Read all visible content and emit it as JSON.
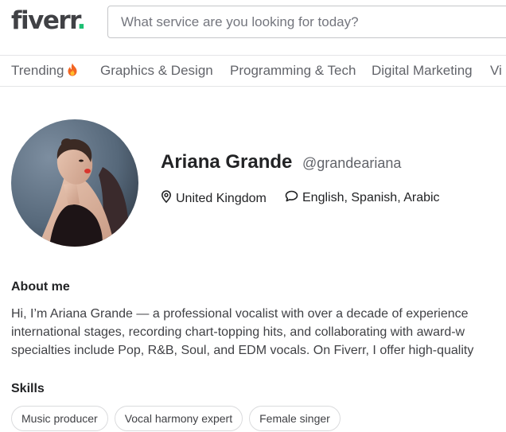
{
  "header": {
    "logo_text": "fiverr",
    "logo_dot": ".",
    "logo_dot_color": "#1dbf73",
    "search_placeholder": "What service are you looking for today?"
  },
  "nav": {
    "items": [
      {
        "label": "Trending",
        "icon": "flame-icon"
      },
      {
        "label": "Graphics & Design"
      },
      {
        "label": "Programming & Tech"
      },
      {
        "label": "Digital Marketing"
      },
      {
        "label": "Vi"
      }
    ]
  },
  "profile": {
    "name": "Ariana Grande",
    "handle": "@grandeariana",
    "location": "United Kingdom",
    "location_icon": "location-pin-icon",
    "languages": "English, Spanish, Arabic",
    "languages_icon": "speech-bubble-icon"
  },
  "about": {
    "title": "About me",
    "lines": [
      "Hi, I’m Ariana Grande — a professional vocalist with over a decade of experience",
      "international stages, recording chart-topping hits, and collaborating with award-w",
      "specialties include Pop, R&B, Soul, and EDM vocals. On Fiverr, I offer high-quality"
    ]
  },
  "skills": {
    "title": "Skills",
    "items": [
      "Music producer",
      "Vocal harmony expert",
      "Female singer"
    ]
  }
}
